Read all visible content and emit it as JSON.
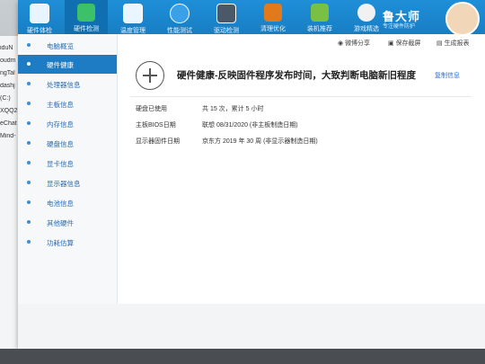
{
  "background_window": {
    "lines": [
      "iduN",
      "oudm",
      "ngTal",
      "dashj",
      "(C:)",
      "XQQ2",
      "eChat",
      "Mind-"
    ]
  },
  "toolbar": {
    "items": [
      {
        "label": "硬件体检",
        "icon": "monitor-icon",
        "active": false
      },
      {
        "label": "硬件检测",
        "icon": "chip-icon",
        "active": true
      },
      {
        "label": "温度管理",
        "icon": "thermometer-icon",
        "active": false
      },
      {
        "label": "性能测试",
        "icon": "gauge-icon",
        "active": false
      },
      {
        "label": "驱动检测",
        "icon": "gear-icon",
        "active": false
      },
      {
        "label": "清理优化",
        "icon": "broom-icon",
        "active": false
      },
      {
        "label": "装机推荐",
        "icon": "cube-icon",
        "active": false
      },
      {
        "label": "游戏精选",
        "icon": "gamepad-icon",
        "active": false
      }
    ],
    "brand_name": "鲁大师",
    "brand_sub": "专注硬件防护"
  },
  "subbar": {
    "share": "微博分享",
    "screenshot": "保存截屏",
    "report": "生成报表"
  },
  "sidebar": {
    "items": [
      {
        "label": "电脑概览",
        "active": false
      },
      {
        "label": "硬件健康",
        "active": true
      },
      {
        "label": "处理器信息",
        "active": false
      },
      {
        "label": "主板信息",
        "active": false
      },
      {
        "label": "内存信息",
        "active": false
      },
      {
        "label": "硬盘信息",
        "active": false
      },
      {
        "label": "显卡信息",
        "active": false
      },
      {
        "label": "显示器信息",
        "active": false
      },
      {
        "label": "电池信息",
        "active": false
      },
      {
        "label": "其他硬件",
        "active": false
      },
      {
        "label": "功耗估算",
        "active": false
      }
    ]
  },
  "main": {
    "headline": "硬件健康-反映固件程序发布时间，大致判断电脑新旧程度",
    "copy_link": "复制信息",
    "rows": [
      {
        "key": "硬盘已使用",
        "value": "共 15 次，累计 5 小时"
      },
      {
        "key": "主板BIOS日期",
        "value": "联想 08/31/2020 (非主板制造日期)"
      },
      {
        "key": "显示器固件日期",
        "value": "京东方 2019 年 30 周 (非显示器制造日期)"
      }
    ]
  },
  "colors": {
    "toolbar": "#1f8fd8",
    "active_nav": "#1d7cc4",
    "link": "#2a6fd0"
  }
}
